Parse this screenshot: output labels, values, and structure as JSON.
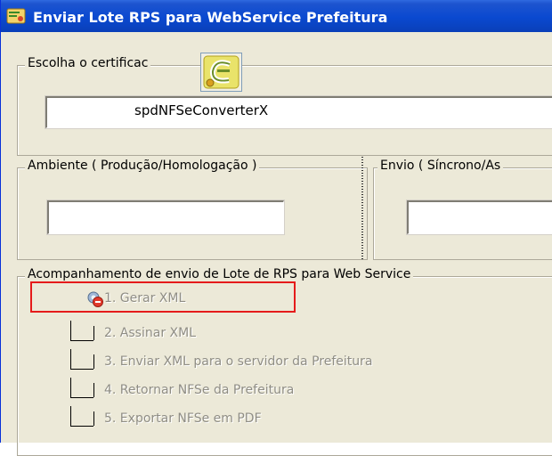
{
  "window": {
    "title": "Enviar Lote RPS para WebService Prefeitura",
    "icon": "green-certificate-icon"
  },
  "certificate": {
    "legend": "Escolha o certificac",
    "value": "spdNFSeConverterX",
    "button_icon": "certificate-badge-icon"
  },
  "ambiente": {
    "legend": "Ambiente ( Produção/Homologação )",
    "value": ""
  },
  "envio": {
    "legend": "Envio ( Síncrono/As",
    "value": ""
  },
  "tracking": {
    "legend": "Acompanhamento de envio de Lote de RPS para Web Service",
    "steps": [
      {
        "label": "1. Gerar XML",
        "icon": "gear-error-icon"
      },
      {
        "label": "2. Assinar XML"
      },
      {
        "label": "3. Enviar XML para o servidor da Prefeitura"
      },
      {
        "label": "4. Retornar NFSe da Prefeitura"
      },
      {
        "label": "5. Exportar NFSe em PDF"
      }
    ]
  },
  "colors": {
    "titlebar": "#0a49d0",
    "highlight": "#e51b1b",
    "disabled_text": "#8f8d84"
  }
}
